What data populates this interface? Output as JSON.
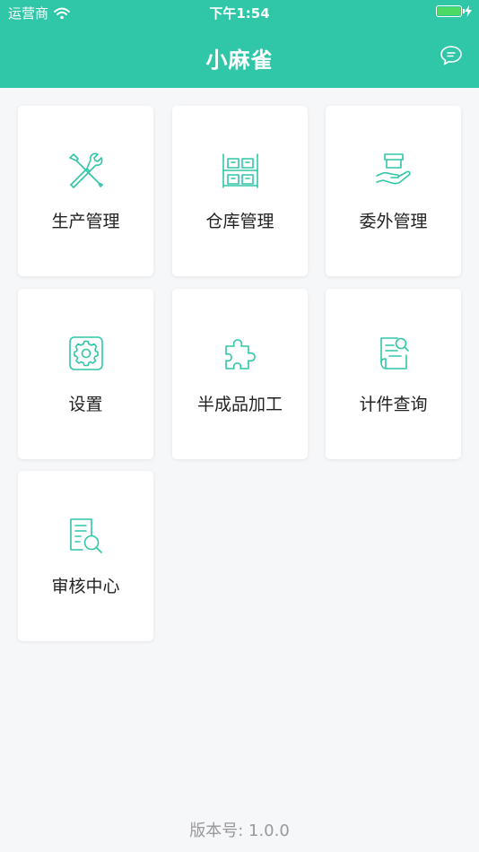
{
  "status_bar": {
    "carrier": "运营商",
    "time": "下午1:54",
    "battery_color": "#4cd964"
  },
  "header": {
    "title": "小麻雀",
    "background": "#30c6a8",
    "right_icon": "chat-bubble-icon"
  },
  "tiles": [
    {
      "label": "生产管理",
      "icon": "tools-icon"
    },
    {
      "label": "仓库管理",
      "icon": "warehouse-shelf-icon"
    },
    {
      "label": "委外管理",
      "icon": "outsource-hand-box-icon"
    },
    {
      "label": "设置",
      "icon": "gear-icon"
    },
    {
      "label": "半成品加工",
      "icon": "puzzle-icon"
    },
    {
      "label": "计件查询",
      "icon": "document-search-icon"
    },
    {
      "label": "审核中心",
      "icon": "audit-search-icon"
    }
  ],
  "accent_color": "#30c6a8",
  "footer": {
    "version": "版本号: 1.0.0"
  }
}
